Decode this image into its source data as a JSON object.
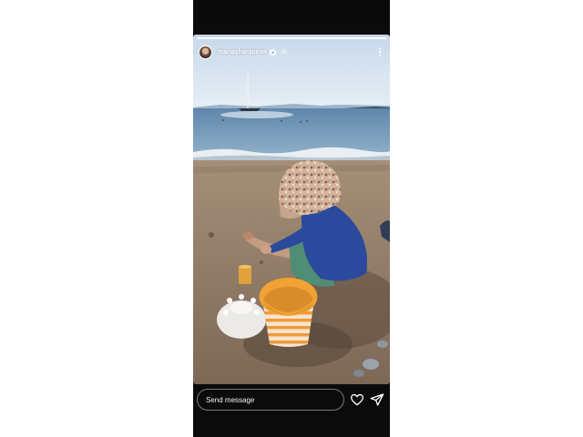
{
  "story": {
    "username": "mariasharapova",
    "timestamp": "3h",
    "progress": 1.0,
    "icons": {
      "verified": "verified-badge-icon",
      "more": "more-options-icon"
    }
  },
  "footer": {
    "message_placeholder": "Send message",
    "icons": {
      "like": "heart-icon",
      "share": "send-icon"
    }
  },
  "colors": {
    "background": "#ffffff",
    "phone_frame": "#0b0b0b",
    "bucket_orange": "#f0a233",
    "shirt_blue": "#2b4a9e"
  }
}
